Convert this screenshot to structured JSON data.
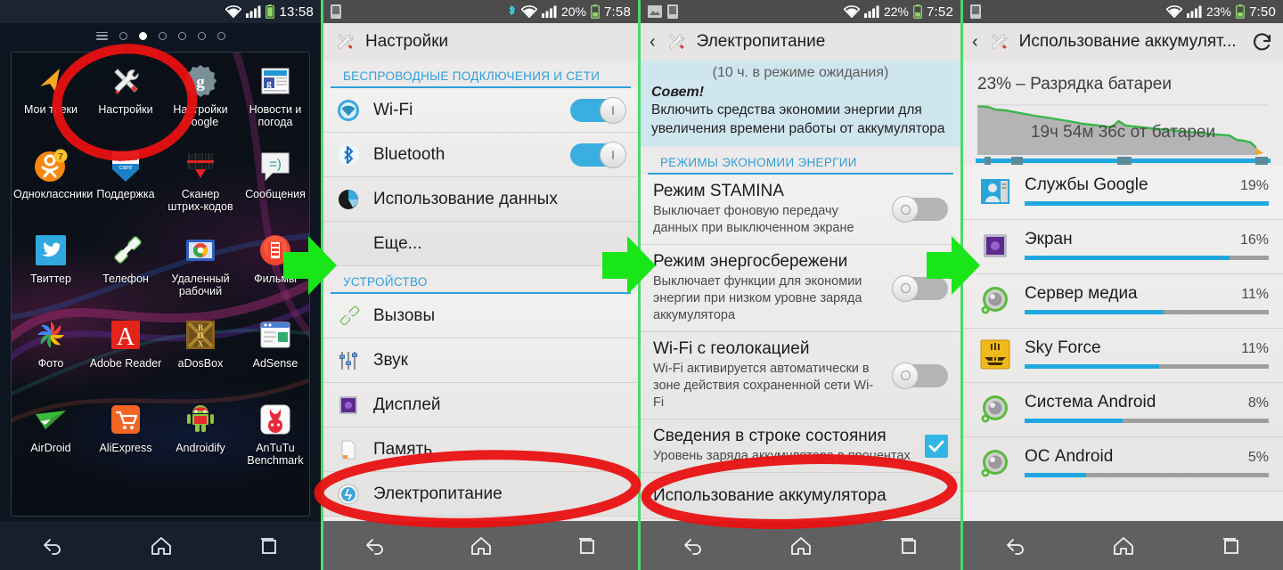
{
  "panels": [
    {
      "id": "home-screen",
      "statusbar": {
        "time": "13:58",
        "battery_pct": "",
        "icons": [
          "wifi-icon",
          "signal-icon",
          "battery-icon"
        ]
      },
      "page_dots": {
        "total": 6,
        "active_index": 1
      },
      "apps": [
        {
          "label": "Мои треки",
          "icon": "mytracks-icon"
        },
        {
          "label": "Настройки",
          "icon": "settings-tools-icon"
        },
        {
          "label": "Настройки Google",
          "icon": "google-settings-icon"
        },
        {
          "label": "Новости и погода",
          "icon": "news-weather-icon"
        },
        {
          "label": "Одноклассники",
          "icon": "odnoklassniki-icon"
        },
        {
          "label": "Поддержка",
          "icon": "xperia-care-icon"
        },
        {
          "label": "Сканер штрих-кодов",
          "icon": "barcode-scanner-icon"
        },
        {
          "label": "Сообщения",
          "icon": "messaging-icon"
        },
        {
          "label": "Твиттер",
          "icon": "twitter-icon"
        },
        {
          "label": "Телефон",
          "icon": "phone-icon"
        },
        {
          "label": "Удаленный рабочий",
          "icon": "remote-desktop-icon"
        },
        {
          "label": "Фильмы",
          "icon": "movies-icon"
        },
        {
          "label": "Фото",
          "icon": "photos-icon"
        },
        {
          "label": "Adobe Reader",
          "icon": "adobe-reader-icon"
        },
        {
          "label": "aDosBox",
          "icon": "adosbox-icon"
        },
        {
          "label": "AdSense",
          "icon": "adsense-icon"
        },
        {
          "label": "AirDroid",
          "icon": "airdroid-icon"
        },
        {
          "label": "AliExpress",
          "icon": "aliexpress-icon"
        },
        {
          "label": "Androidify",
          "icon": "androidify-icon"
        },
        {
          "label": "AnTuTu Benchmark",
          "icon": "antutu-icon"
        }
      ],
      "navbar": [
        "back-icon",
        "home-icon",
        "recents-icon"
      ]
    },
    {
      "id": "settings",
      "statusbar": {
        "time": "7:58",
        "battery_pct": "20%",
        "icons": [
          "sim-icon",
          "bluetooth-icon",
          "wifi-icon",
          "signal-icon",
          "battery-icon"
        ]
      },
      "title": "Настройки",
      "title_icon": "settings-tools-icon",
      "sections": [
        {
          "header": "БЕСПРОВОДНЫЕ ПОДКЛЮЧЕНИЯ И СЕТИ",
          "rows": [
            {
              "label": "Wi-Fi",
              "icon": "wifi-circle-icon",
              "toggle": "on"
            },
            {
              "label": "Bluetooth",
              "icon": "bluetooth-circle-icon",
              "toggle": "on"
            },
            {
              "label": "Использование данных",
              "icon": "data-usage-icon",
              "toggle": null
            },
            {
              "label": "Еще...",
              "icon": null,
              "toggle": null
            }
          ]
        },
        {
          "header": "УСТРОЙСТВО",
          "rows": [
            {
              "label": "Вызовы",
              "icon": "calls-icon",
              "toggle": null
            },
            {
              "label": "Звук",
              "icon": "sound-icon",
              "toggle": null
            },
            {
              "label": "Дисплей",
              "icon": "display-icon",
              "toggle": null
            },
            {
              "label": "Память",
              "icon": "storage-icon",
              "toggle": null
            },
            {
              "label": "Электропитание",
              "icon": "power-icon",
              "toggle": null,
              "highlighted": true
            }
          ]
        }
      ],
      "navbar": [
        "back-icon",
        "home-icon",
        "recents-icon"
      ]
    },
    {
      "id": "power-management",
      "statusbar": {
        "time": "7:52",
        "battery_pct": "22%",
        "icons": [
          "image-icon",
          "sim-icon",
          "wifi-icon",
          "signal-icon",
          "battery-icon"
        ]
      },
      "title": "Электропитание",
      "title_icon": "settings-tools-icon",
      "cut_line": "(10 ч. в режиме ожидания)",
      "tip": {
        "heading": "Совет!",
        "body": "Включить средства экономии энергии для увеличения времени работы от аккумулятора"
      },
      "section_header": "РЕЖИМЫ ЭКОНОМИИ ЭНЕРГИИ",
      "rows": [
        {
          "title": "Режим STAMINA",
          "subtitle": "Выключает фоновую передачу данных при выключенном экране",
          "control": "toggle-off"
        },
        {
          "title": "Режим энергосбережени",
          "subtitle": "Выключает функции для экономии энергии при низком уровне заряда аккумулятора",
          "control": "toggle-off"
        },
        {
          "title": "Wi-Fi с геолокацией",
          "subtitle": "Wi-Fi активируется автоматически в зоне действия сохраненной сети Wi-Fi",
          "control": "toggle-off"
        },
        {
          "title": "Сведения в строке состояния",
          "subtitle": "Уровень заряда аккумулятора в процентах",
          "control": "checkbox-checked"
        },
        {
          "title": "Использование аккумулятора",
          "subtitle": "",
          "control": "none",
          "highlighted": true
        }
      ],
      "navbar": [
        "back-icon",
        "home-icon",
        "recents-icon"
      ]
    },
    {
      "id": "battery-usage",
      "statusbar": {
        "time": "7:50",
        "battery_pct": "23%",
        "icons": [
          "sim-icon",
          "wifi-icon",
          "signal-icon",
          "battery-icon"
        ]
      },
      "title": "Использование аккумулят...",
      "title_icon": "settings-tools-icon",
      "refresh_icon": "refresh-icon",
      "summary": "23% – Разрядка батареи",
      "graph_label": "19ч 54м 36с от батареи",
      "items": [
        {
          "name": "Служба Google",
          "label": "Службы Google",
          "pct": "19%",
          "value": 19,
          "icon": "google-services-icon"
        },
        {
          "name": "screen",
          "label": "Экран",
          "pct": "16%",
          "value": 16,
          "icon": "display-icon"
        },
        {
          "name": "media-server",
          "label": "Сервер медиа",
          "pct": "11%",
          "value": 11,
          "icon": "android-app-icon"
        },
        {
          "name": "sky-force",
          "label": "Sky Force",
          "pct": "11%",
          "value": 11,
          "icon": "sky-force-icon"
        },
        {
          "name": "android-system",
          "label": "Система Android",
          "pct": "8%",
          "value": 8,
          "icon": "android-app-icon"
        },
        {
          "name": "android-os",
          "label": "ОС Android",
          "pct": "5%",
          "value": 5,
          "icon": "android-app-icon"
        }
      ],
      "navbar": [
        "back-icon",
        "home-icon",
        "recents-icon"
      ]
    }
  ],
  "annotations": {
    "arrows": [
      {
        "name": "arrow-home-to-settings",
        "color": "#19e619"
      },
      {
        "name": "arrow-settings-to-power",
        "color": "#19e619"
      },
      {
        "name": "arrow-power-to-battery",
        "color": "#19e619"
      }
    ],
    "circles": [
      {
        "name": "circle-settings-app",
        "color": "#e81111"
      },
      {
        "name": "circle-power-row",
        "color": "#e81111"
      },
      {
        "name": "circle-battery-usage-row",
        "color": "#e81111"
      }
    ],
    "marker_color": "#e81111",
    "arrow_color": "#19e619"
  }
}
